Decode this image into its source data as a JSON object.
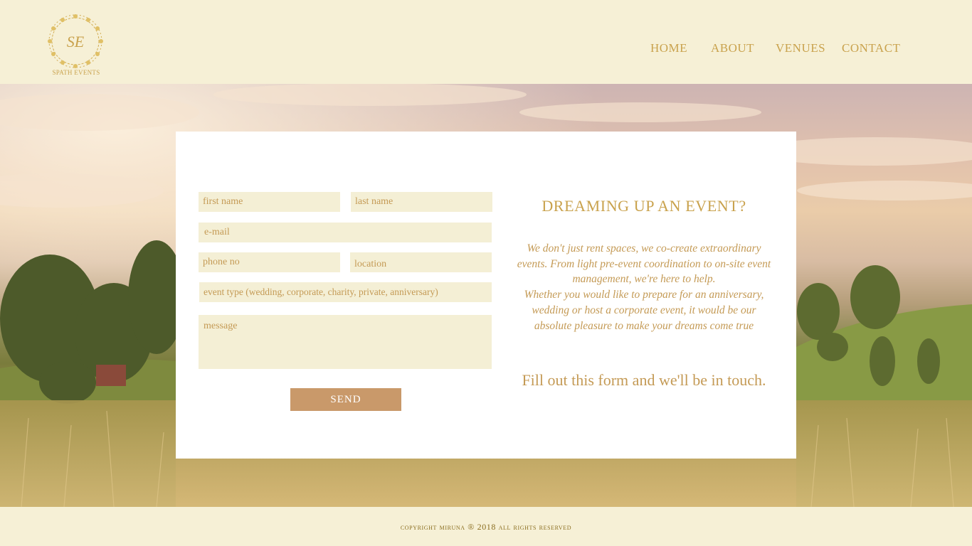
{
  "brand": {
    "monogram": "SE",
    "name": "SPATH EVENTS",
    "accent_color": "#c9a24d"
  },
  "nav": {
    "items": [
      {
        "label": "HOME"
      },
      {
        "label": "ABOUT"
      },
      {
        "label": "VENUES"
      },
      {
        "label": "CONTACT"
      }
    ]
  },
  "form": {
    "first_name_placeholder": "first name",
    "last_name_placeholder": "last name",
    "email_placeholder": "e-mail",
    "phone_placeholder": "phone no",
    "location_placeholder": "location",
    "event_type_placeholder": "event type (wedding, corporate, charity, private, anniversary)",
    "message_placeholder": "message",
    "send_label": "SEND",
    "field_color": "#f4efd5",
    "button_color": "#c9996a"
  },
  "intro": {
    "title": "DREAMING UP AN EVENT?",
    "paragraph_1": "We don't just rent spaces, we co-create extraordinary events. From light pre-event coordination to on-site event management, we're here to help.",
    "paragraph_2": "Whether you would like to prepare for an anniversary, wedding or host a corporate event, it would be our absolute pleasure to make your dreams come true",
    "cta": "Fill out this form and we'll be in touch."
  },
  "footer": {
    "copyright": "copyright miruna ® 2018 all rights reserved"
  }
}
